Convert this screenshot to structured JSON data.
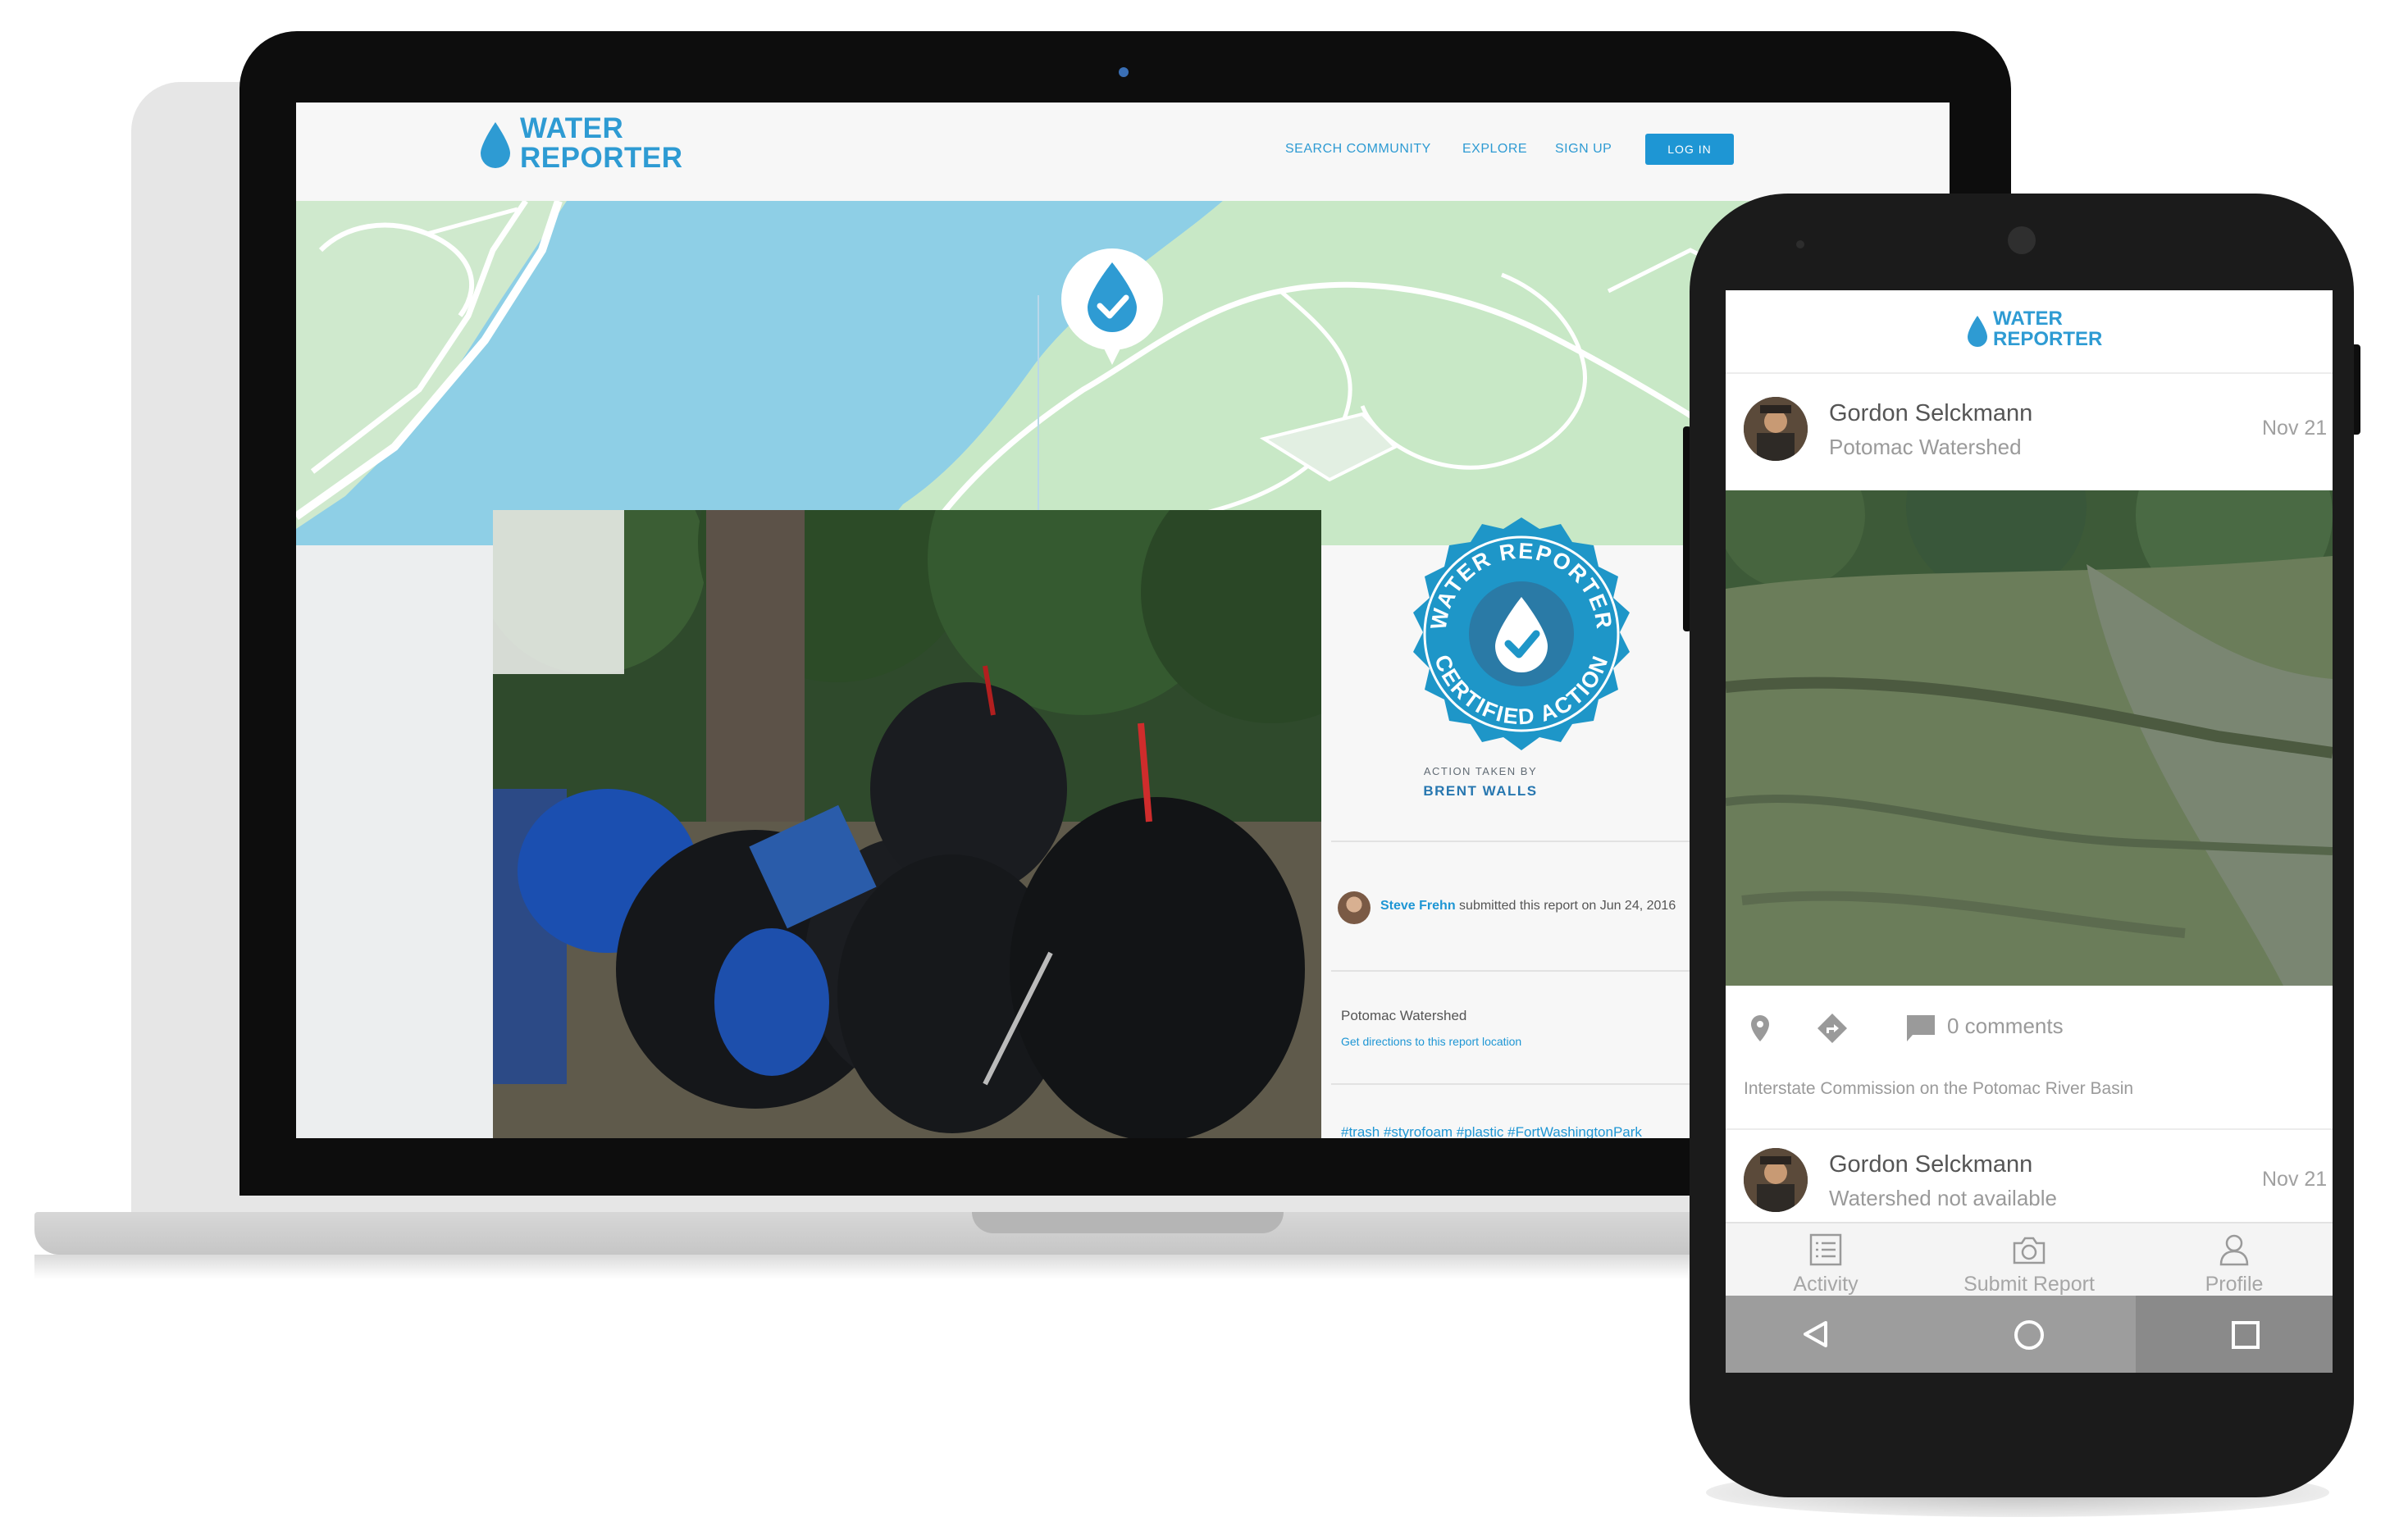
{
  "colors": {
    "brand_blue": "#2e9bd3",
    "button_blue": "#1e96d4",
    "map_water": "#8ecfe6",
    "map_land": "#c9e8c8",
    "android_nav": "#9d9d9d"
  },
  "website": {
    "logo": {
      "line1": "WATER",
      "line2": "REPORTER",
      "icon": "water-drop-icon"
    },
    "nav": [
      "SEARCH COMMUNITY",
      "EXPLORE",
      "SIGN UP"
    ],
    "login_label": "LOG IN",
    "map_pin_icon": "check-drop-icon",
    "report": {
      "badge": {
        "top_text": "WATER REPORTER",
        "bottom_text": "CERTIFIED ACTION",
        "icon": "check-drop-icon"
      },
      "action_taken_by_label": "ACTION TAKEN BY",
      "action_taken_by_name": "BRENT WALLS",
      "submitter_name": "Steve Frehn",
      "submitter_text": "submitted this report on Jun 24, 2016",
      "watershed": "Potomac Watershed",
      "directions_link": "Get directions to this report location",
      "hashtags": "#trash #styrofoam #plastic #FortWashingtonPark"
    }
  },
  "mobile_app": {
    "logo": {
      "line1": "WATER",
      "line2": "REPORTER"
    },
    "posts": [
      {
        "user": "Gordon Selckmann",
        "watershed": "Potomac Watershed",
        "date": "Nov 21",
        "comments": "0 comments",
        "organization": "Interstate Commission on the Potomac River Basin"
      },
      {
        "user": "Gordon Selckmann",
        "watershed": "Watershed not available",
        "date": "Nov 21"
      }
    ],
    "tabs": [
      {
        "label": "Activity",
        "icon": "list-icon"
      },
      {
        "label": "Submit Report",
        "icon": "camera-icon"
      },
      {
        "label": "Profile",
        "icon": "person-icon"
      }
    ],
    "system_nav": [
      "back-icon",
      "home-icon",
      "recents-icon"
    ]
  }
}
